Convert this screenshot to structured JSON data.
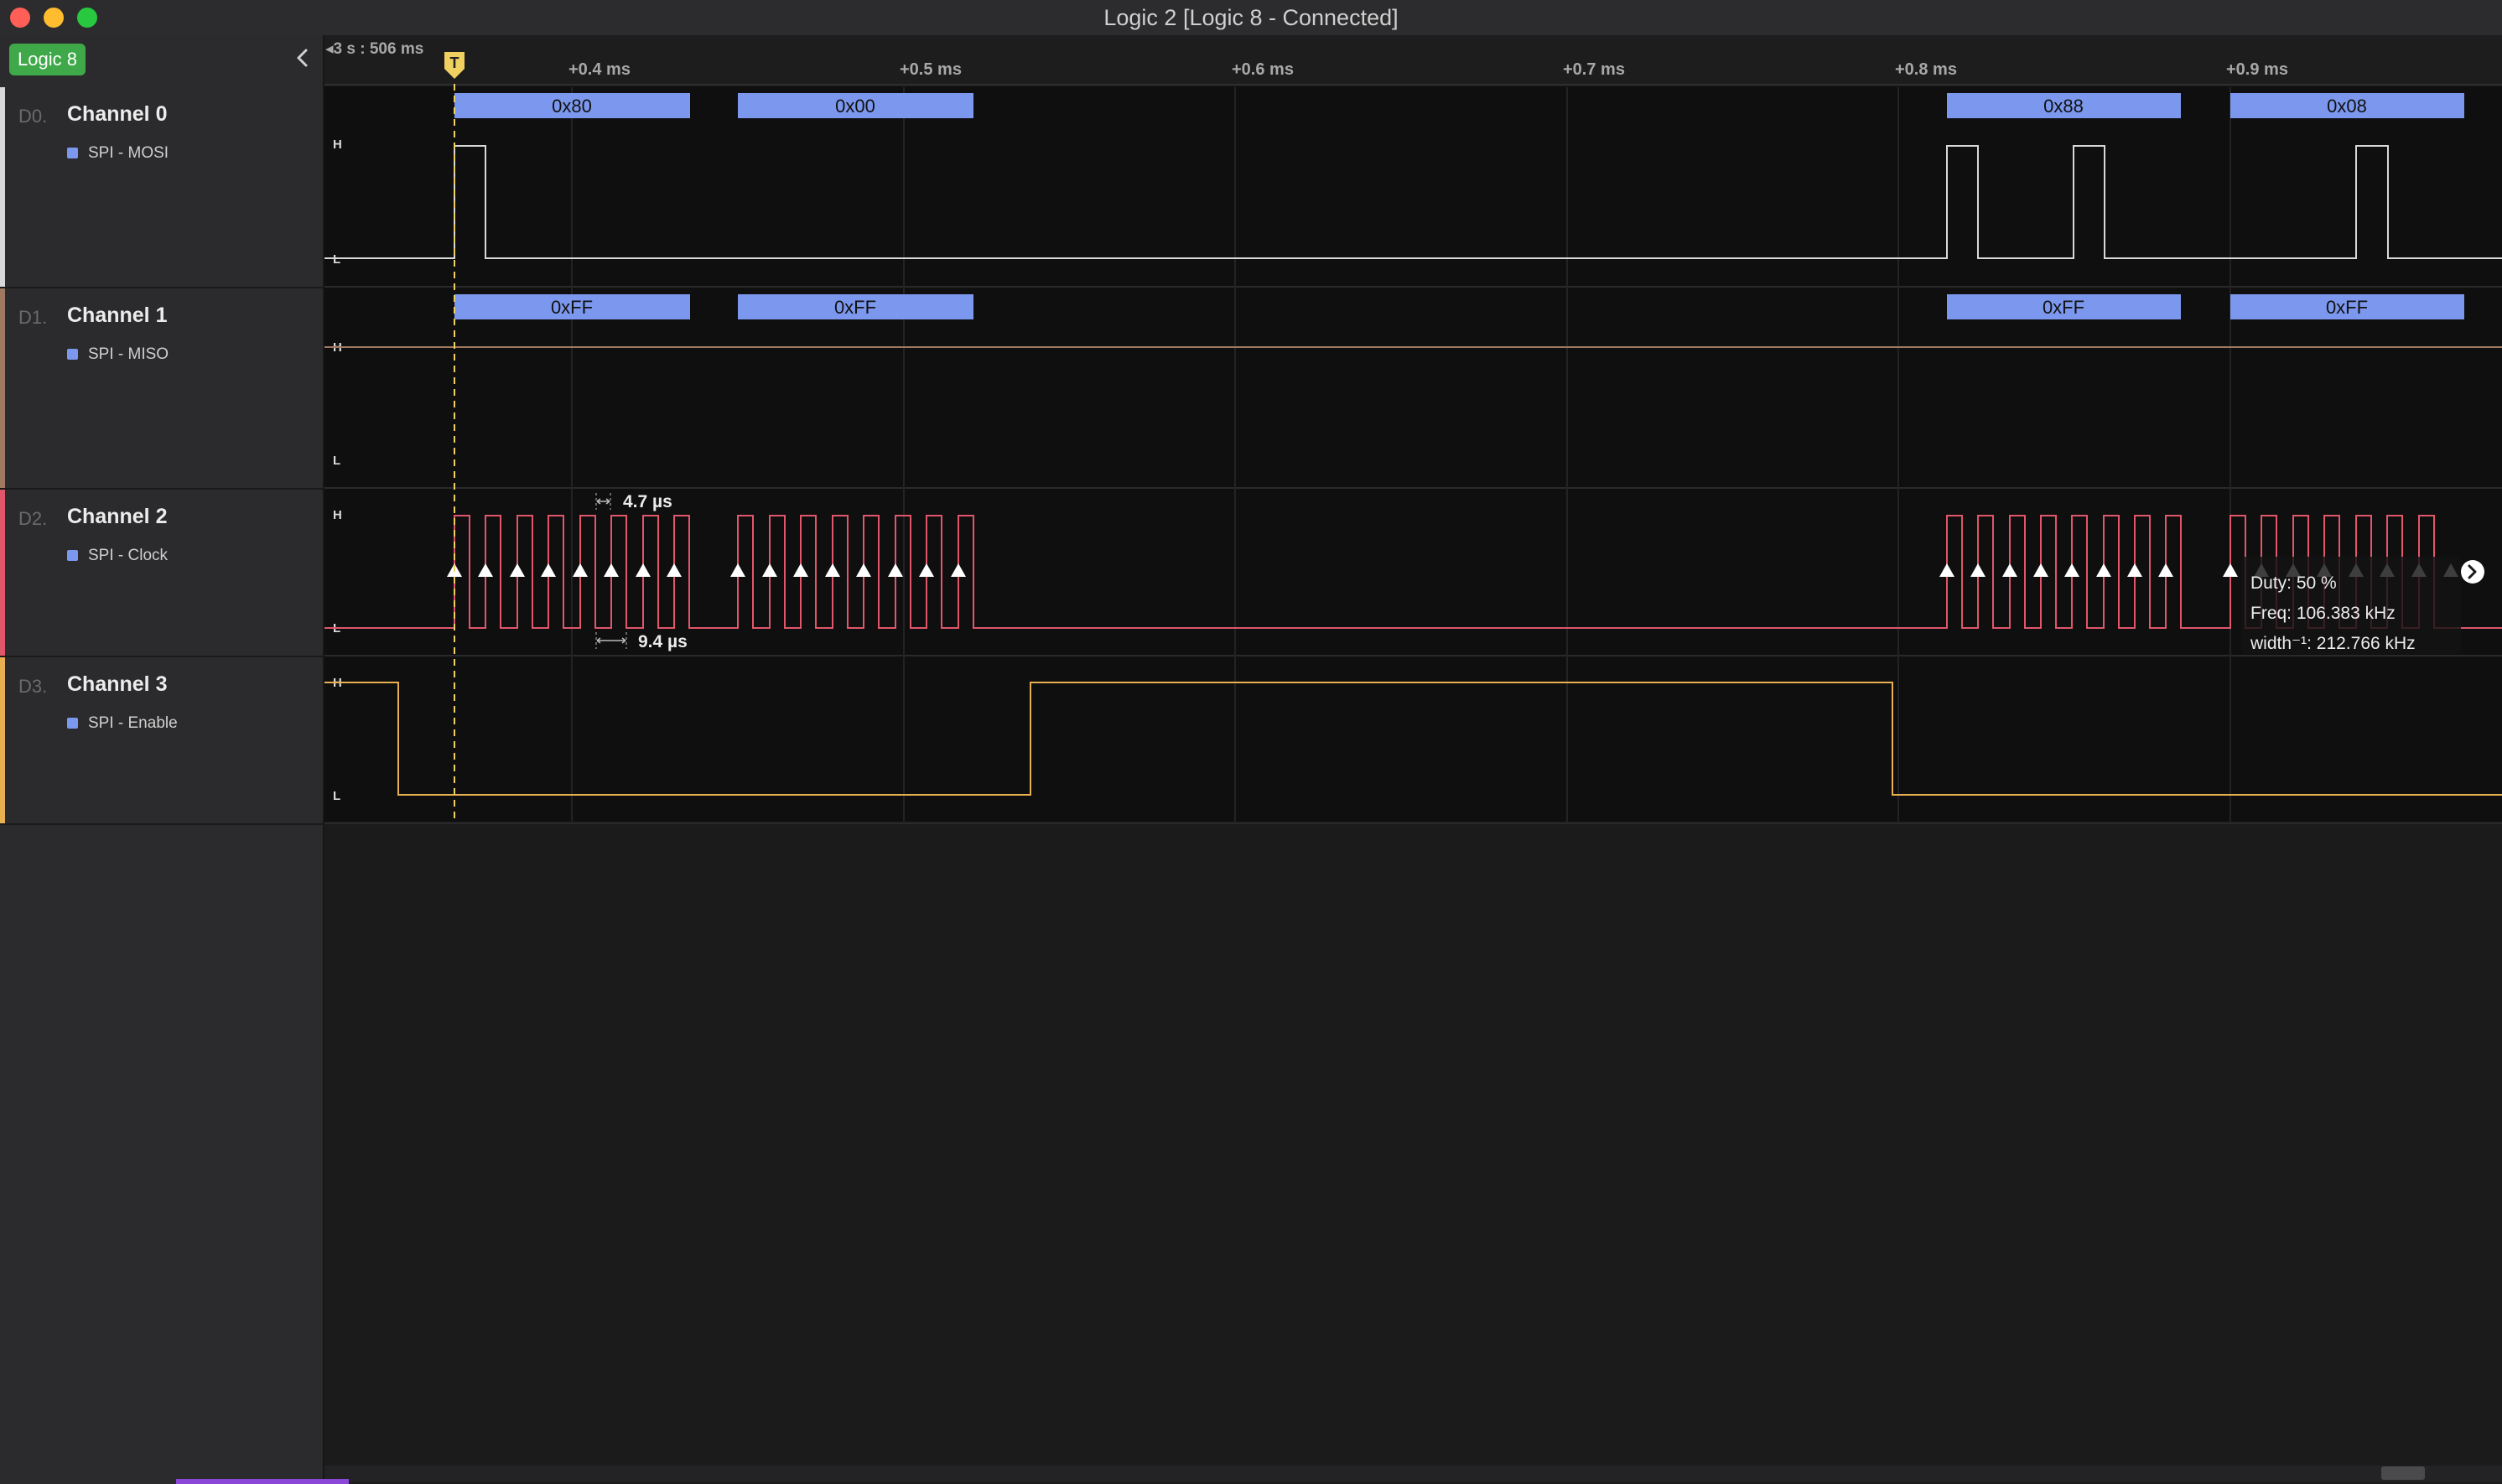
{
  "window": {
    "title": "Logic 2 [Logic 8 - Connected]"
  },
  "sidebar": {
    "device_badge": "Logic 8",
    "channels": [
      {
        "index": "D0.",
        "name": "Channel 0",
        "analyzer": "SPI - MOSI",
        "color": "#d8d8d8"
      },
      {
        "index": "D1.",
        "name": "Channel 1",
        "analyzer": "SPI - MISO",
        "color": "#a07a60"
      },
      {
        "index": "D2.",
        "name": "Channel 2",
        "analyzer": "SPI - Clock",
        "color": "#e0566a"
      },
      {
        "index": "D3.",
        "name": "Channel 3",
        "analyzer": "SPI - Enable",
        "color": "#e8b050"
      }
    ]
  },
  "timeline": {
    "offset_label": "3 s : 506 ms",
    "trigger_label": "T",
    "ticks": [
      "+0.4 ms",
      "+0.5 ms",
      "+0.6 ms",
      "+0.7 ms",
      "+0.8 ms",
      "+0.9 ms"
    ]
  },
  "level_labels": {
    "high": "H",
    "low": "L"
  },
  "decoded": {
    "mosi": [
      "0x80",
      "0x00",
      "0x88",
      "0x08"
    ],
    "miso": [
      "0xFF",
      "0xFF",
      "0xFF",
      "0xFF"
    ]
  },
  "measurements": {
    "pulse_width": "4.7 µs",
    "period": "9.4 µs",
    "tooltip": {
      "duty": "Duty: 50 %",
      "freq": "Freq: 106.383 kHz",
      "width_inv": "width⁻¹: 212.766 kHz"
    }
  },
  "colors": {
    "ch0": "#d8d8d8",
    "ch1": "#a07a60",
    "ch2": "#e0566a",
    "ch3": "#e8b050",
    "analyzer": "#7c98ee",
    "trigger": "#f0d060",
    "badge": "#3fa94a"
  }
}
